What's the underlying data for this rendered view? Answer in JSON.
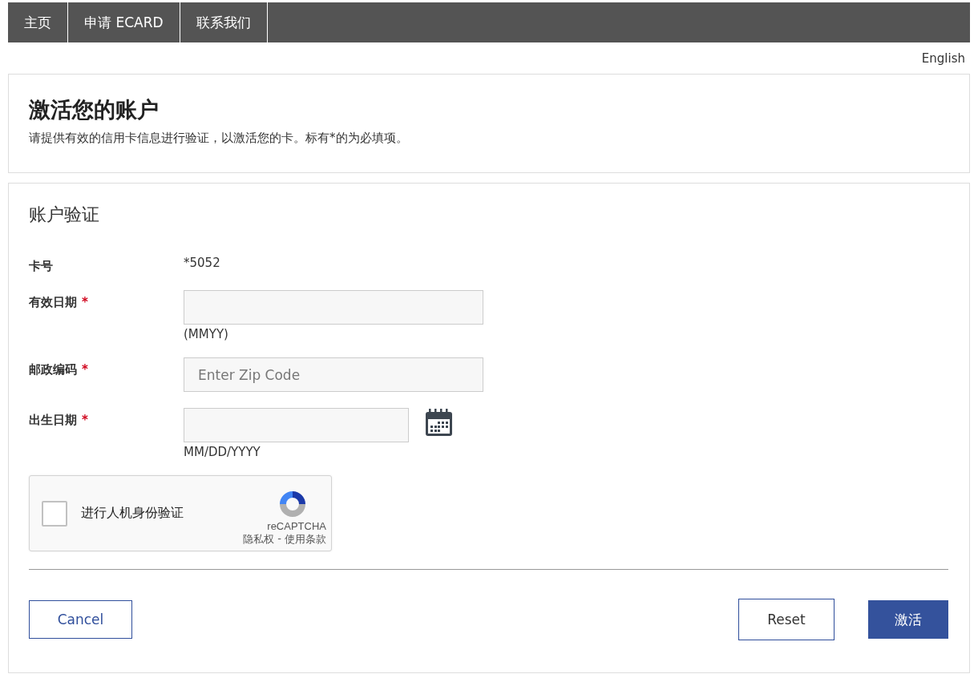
{
  "nav": [
    {
      "label": "主页"
    },
    {
      "label": "申请 ECARD"
    },
    {
      "label": "联系我们"
    }
  ],
  "language": "English",
  "intro": {
    "title": "激活您的账户",
    "description": "请提供有效的信用卡信息进行验证，以激活您的卡。标有*的为必填项。"
  },
  "form": {
    "title": "账户验证",
    "fields": [
      {
        "kind": "text",
        "label": "卡号",
        "value": "*5052"
      },
      {
        "kind": "input",
        "label": "有效日期",
        "required_mark": "*",
        "hint": "(MMYY)"
      },
      {
        "kind": "input",
        "label": "邮政编码",
        "required_mark": "*",
        "placeholder": "Enter Zip Code"
      },
      {
        "kind": "date",
        "label": "出生日期",
        "required_mark": "*",
        "hint": "MM/DD/YYYY"
      }
    ],
    "captcha": {
      "checked": false,
      "label": "进行人机身份验证",
      "brand": "reCAPTCHA",
      "privacy": "隐私权",
      "separator": "-",
      "terms": "使用条款"
    },
    "buttons": [
      {
        "kind": "outline",
        "label": "Cancel"
      },
      {
        "kind": "outline",
        "label": "Reset"
      },
      {
        "kind": "primary",
        "label": "激活"
      }
    ]
  }
}
